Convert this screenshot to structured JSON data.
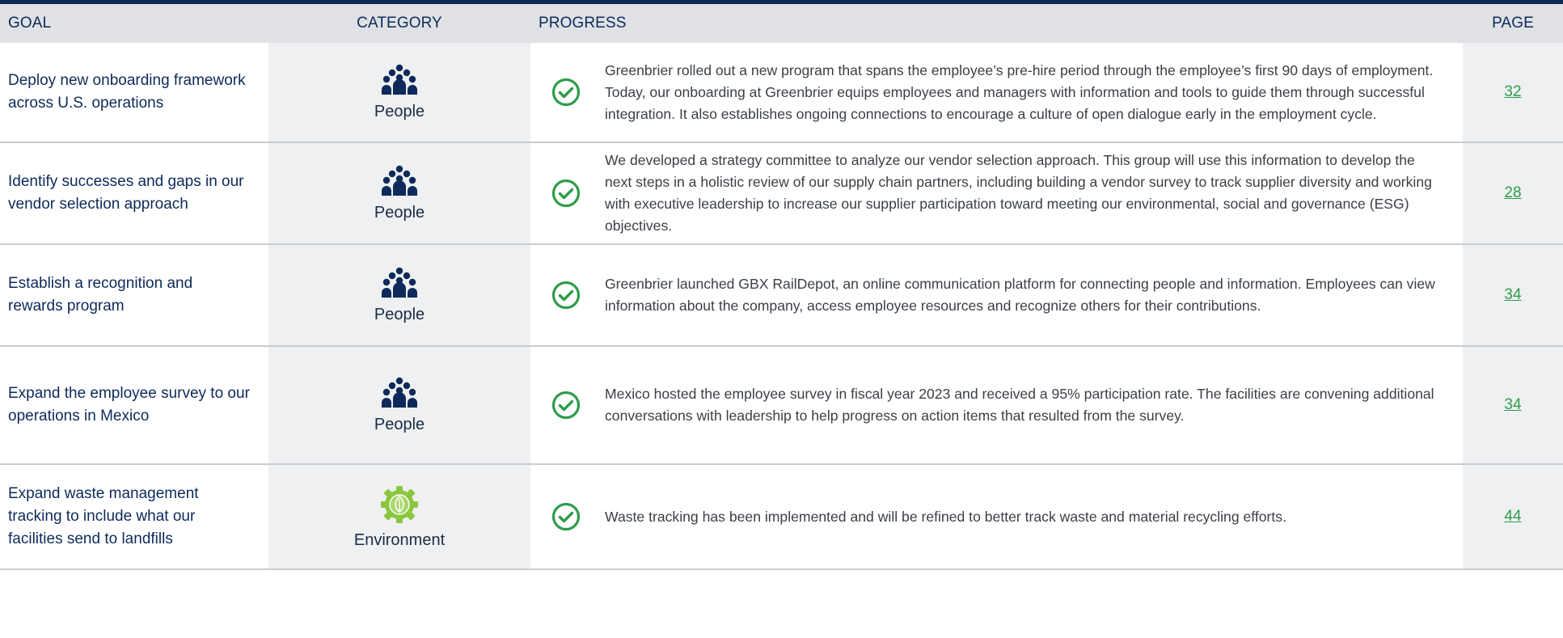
{
  "header": {
    "goal": "GOAL",
    "category": "CATEGORY",
    "progress": "PROGRESS",
    "page": "PAGE"
  },
  "colors": {
    "navy": "#0d2a5a",
    "green_check": "#2e9c4a",
    "env_green": "#8cc63f",
    "header_bg": "#dfe1e4",
    "cell_bg": "#eef0f1"
  },
  "rows": [
    {
      "goal": "Deploy new onboarding framework across U.S. operations",
      "category": "People",
      "category_icon": "people-icon",
      "progress": "Greenbrier rolled out a new program that spans the employee’s pre-hire period through the employee’s first 90 days of employment. Today, our onboarding at Greenbrier equips employees and managers with information and tools to guide them through successful integration. It also establishes ongoing connections to encourage a culture of open dialogue early in the employment cycle.",
      "page": "32"
    },
    {
      "goal": "Identify successes and gaps in our vendor selection approach",
      "category": "People",
      "category_icon": "people-icon",
      "progress": "We developed a strategy committee to analyze our vendor selection approach. This group will use this information to develop the next steps in a holistic review of our supply chain partners, including building a vendor survey to track supplier diversity and working with executive leadership to increase our supplier participation toward meeting our environmental, social and governance (ESG) objectives.",
      "page": "28"
    },
    {
      "goal": "Establish a recognition and rewards program",
      "category": "People",
      "category_icon": "people-icon",
      "progress": "Greenbrier launched GBX RailDepot, an online communication platform for connecting people and information. Employees can view information about the company, access employee resources and recognize others for their contributions.",
      "page": "34"
    },
    {
      "goal": "Expand the employee survey to our operations in Mexico",
      "category": "People",
      "category_icon": "people-icon",
      "progress": "Mexico hosted the employee survey in fiscal year 2023 and received a 95% participation rate. The facilities are convening additional conversations with leadership to help progress on action items that resulted from the survey.",
      "page": "34"
    },
    {
      "goal": "Expand waste management tracking to include what our facilities send to landfills",
      "category": "Environment",
      "category_icon": "gear-leaf-icon",
      "progress": "Waste tracking has been implemented and will be refined to better track waste and material recycling efforts.",
      "page": "44"
    }
  ]
}
